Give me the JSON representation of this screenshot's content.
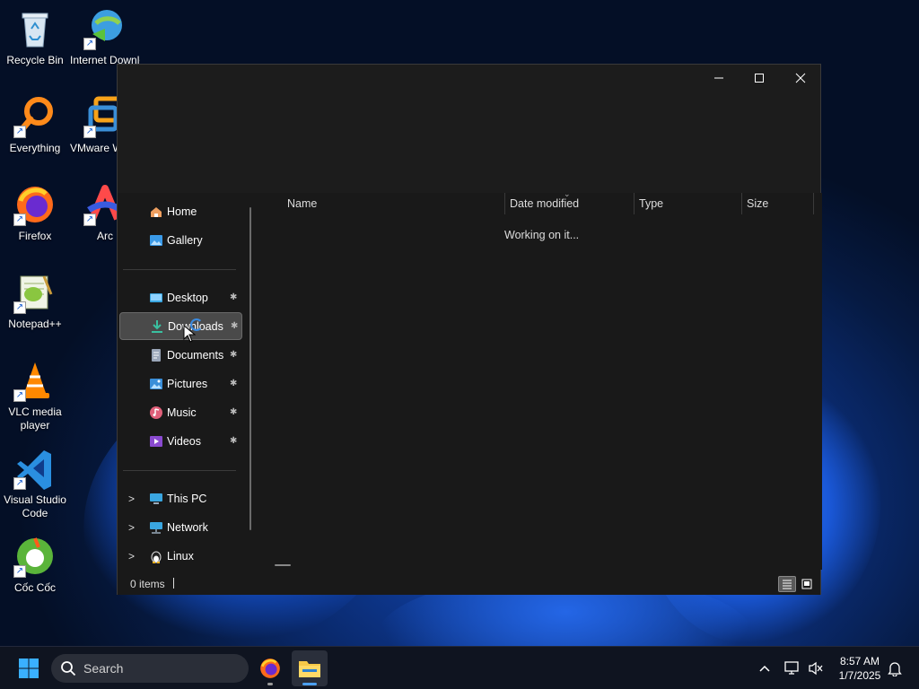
{
  "desktop": {
    "icons": [
      {
        "label": "Recycle Bin"
      },
      {
        "label": "Internet Downlo..."
      },
      {
        "label": "Everything"
      },
      {
        "label": "VMware Worksta..."
      },
      {
        "label": "Firefox"
      },
      {
        "label": "Arc"
      },
      {
        "label": "Notepad++"
      },
      {
        "label": "VLC media player"
      },
      {
        "label": "Visual Studio Code"
      },
      {
        "label": "Cốc Cốc"
      }
    ]
  },
  "explorer": {
    "window_controls": {
      "minimize": "—",
      "maximize": "☐",
      "close": "✕"
    },
    "nav": {
      "top": [
        {
          "label": "Home",
          "icon": "home-icon"
        },
        {
          "label": "Gallery",
          "icon": "gallery-icon"
        }
      ],
      "quick_access": [
        {
          "label": "Desktop",
          "icon": "desktop-folder-icon",
          "pinned": true
        },
        {
          "label": "Downloads",
          "icon": "downloads-folder-icon",
          "pinned": true,
          "selected": true
        },
        {
          "label": "Documents",
          "icon": "documents-folder-icon",
          "pinned": true
        },
        {
          "label": "Pictures",
          "icon": "pictures-folder-icon",
          "pinned": true
        },
        {
          "label": "Music",
          "icon": "music-folder-icon",
          "pinned": true
        },
        {
          "label": "Videos",
          "icon": "videos-folder-icon",
          "pinned": true
        }
      ],
      "locations": [
        {
          "label": "This PC",
          "icon": "this-pc-icon"
        },
        {
          "label": "Network",
          "icon": "network-icon"
        },
        {
          "label": "Linux",
          "icon": "linux-icon"
        }
      ],
      "pin_glyph": "📌",
      "expand_glyph": ">"
    },
    "columns": [
      "Name",
      "Date modified",
      "Type",
      "Size"
    ],
    "loading_text": "Working on it...",
    "status": {
      "items": "0 items"
    }
  },
  "taskbar": {
    "search_placeholder": "Search",
    "clock": {
      "time": "8:57 AM",
      "date": "1/7/2025"
    }
  },
  "colors": {
    "window_bg": "#191919",
    "selected_bg": "#4a4a4a",
    "accent": "#4ca0f0",
    "taskbar_bg": "#0f1420"
  }
}
